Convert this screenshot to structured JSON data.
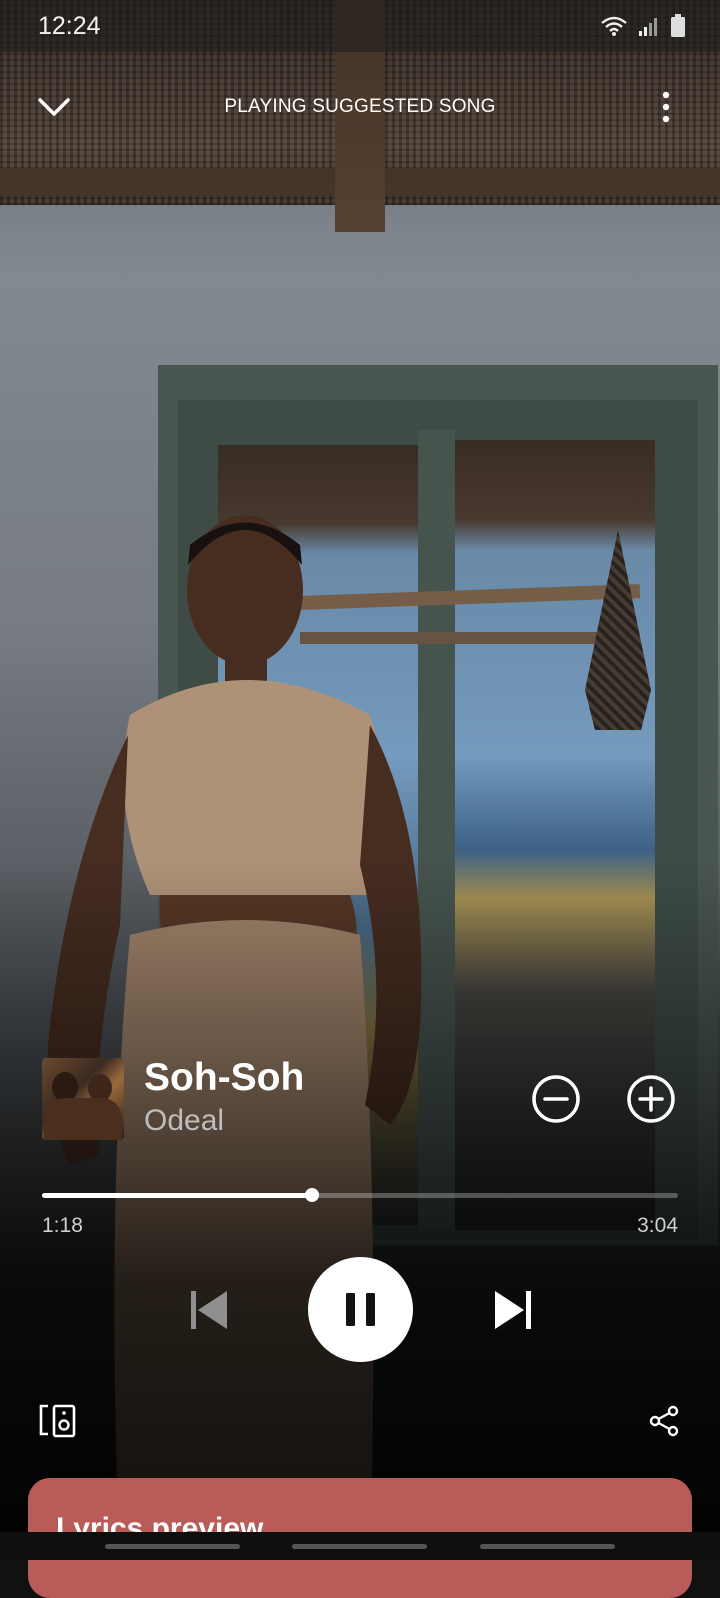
{
  "status_bar": {
    "time": "12:24"
  },
  "header": {
    "title": "PLAYING SUGGESTED SONG"
  },
  "track": {
    "title": "Soh-Soh",
    "artist": "Odeal"
  },
  "progress": {
    "elapsed": "1:18",
    "total": "3:04",
    "fraction": 0.425
  },
  "lyrics": {
    "title": "Lyrics preview"
  },
  "colors": {
    "lyrics_card": "#b95b58",
    "accent": "#ffffff"
  },
  "icons": [
    "chevron-down-icon",
    "more-vert-icon",
    "remove-circle-icon",
    "add-circle-icon",
    "skip-previous-icon",
    "pause-icon",
    "skip-next-icon",
    "devices-icon",
    "share-icon",
    "wifi-icon",
    "signal-icon",
    "battery-icon"
  ]
}
